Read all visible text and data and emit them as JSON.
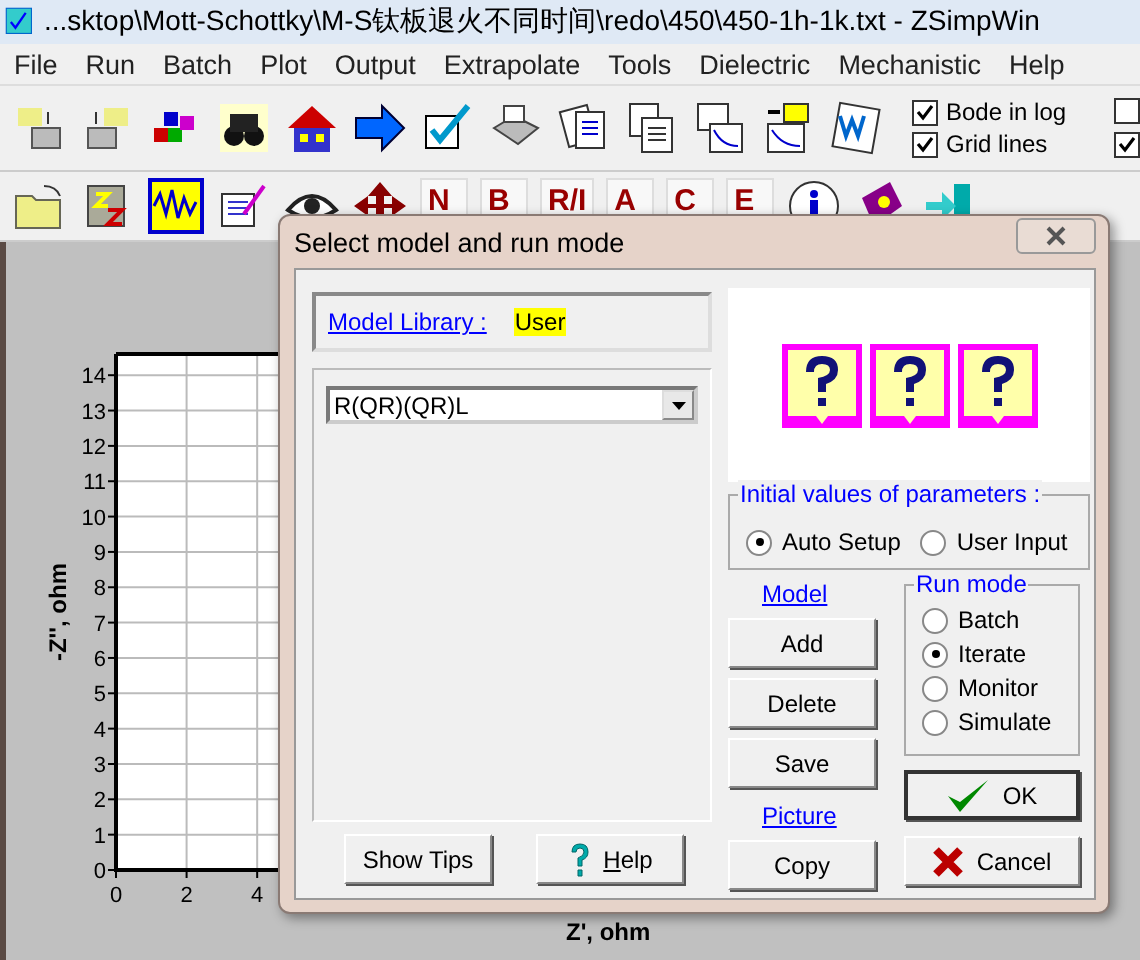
{
  "window": {
    "title": "...sktop\\Mott-Schottky\\M-S钛板退火不同时间\\redo\\450\\450-1h-1k.txt - ZSimpWin"
  },
  "menu": [
    "File",
    "Run",
    "Batch",
    "Plot",
    "Output",
    "Extrapolate",
    "Tools",
    "Dielectric",
    "Mechanistic",
    "Help"
  ],
  "toolbar_options": [
    {
      "label": "Bode in log",
      "checked": true
    },
    {
      "label": "Grid lines",
      "checked": true
    }
  ],
  "edge_checkboxes": [
    {
      "checked": false
    },
    {
      "checked": true
    }
  ],
  "plot_buttons": [
    {
      "label": "N"
    },
    {
      "label": "B"
    },
    {
      "label": "R/I"
    },
    {
      "label": "A"
    },
    {
      "label": "C"
    },
    {
      "label": "E"
    }
  ],
  "plot": {
    "chart_data": {
      "type": "scatter",
      "xlabel": "Z', ohm",
      "ylabel": "-Z'', ohm",
      "xticks": [
        0,
        2,
        4
      ],
      "xlim": [
        0,
        5.1
      ],
      "ylim": [
        0,
        14.6
      ],
      "grid": true,
      "yticks": [
        0,
        1,
        2,
        3,
        4,
        5,
        6,
        7,
        8,
        9,
        10,
        11,
        12,
        13,
        14
      ]
    }
  },
  "dialog": {
    "title": "Select model and run mode",
    "model_library_link": "Model Library :",
    "model_library": "User",
    "model": "R(QR)(QR)L",
    "initial_values": {
      "title": "Initial values of parameters :",
      "options": [
        {
          "label": "Auto Setup",
          "selected": true
        },
        {
          "label": "User Input",
          "selected": false
        }
      ]
    },
    "model_link": "Model",
    "model_buttons": [
      "Add",
      "Delete",
      "Save"
    ],
    "picture_link": "Picture",
    "copy": "Copy",
    "run_mode": {
      "title": "Run mode",
      "options": [
        {
          "label": "Batch",
          "selected": false
        },
        {
          "label": "Iterate",
          "selected": true
        },
        {
          "label": "Monitor",
          "selected": false
        },
        {
          "label": "Simulate",
          "selected": false
        }
      ]
    },
    "ok": "OK",
    "cancel": "Cancel",
    "show_tips": "Show Tips",
    "help": "Help"
  }
}
